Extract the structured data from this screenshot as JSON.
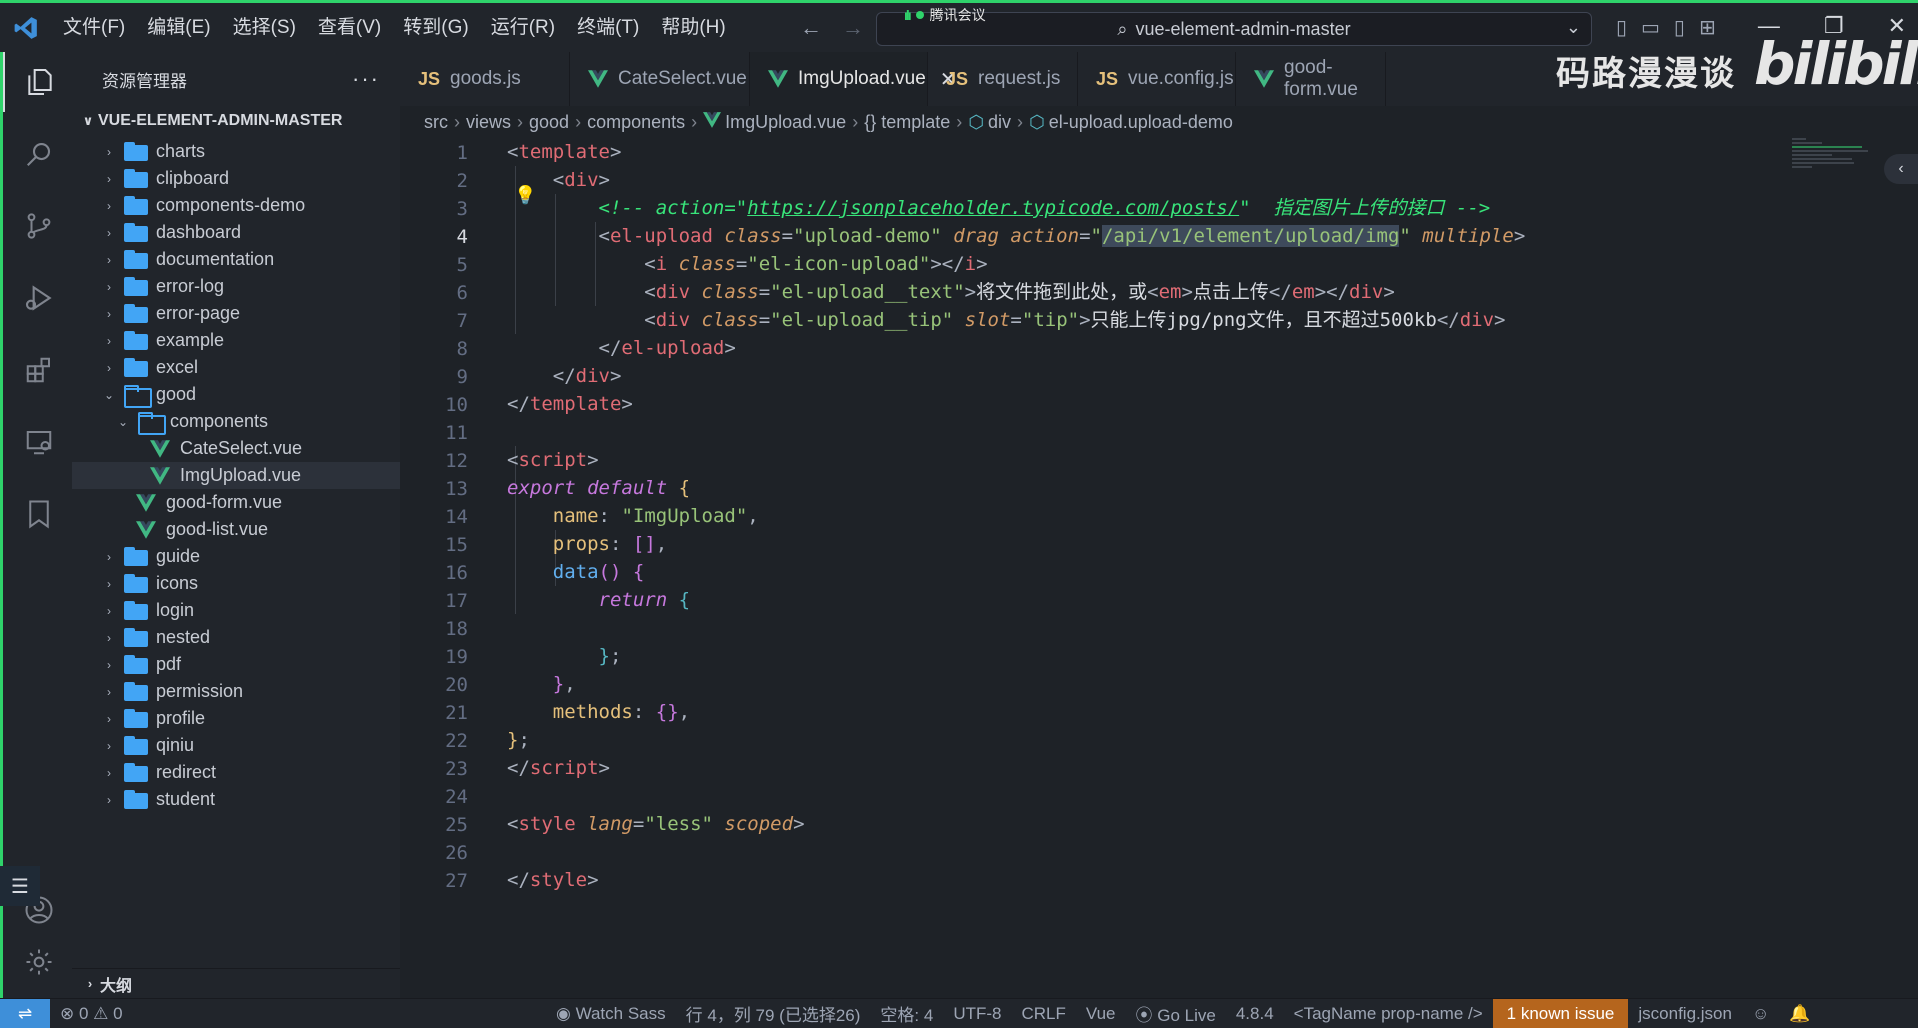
{
  "titlebar": {
    "menu": [
      "文件(F)",
      "编辑(E)",
      "选择(S)",
      "查看(V)",
      "转到(G)",
      "运行(R)",
      "终端(T)",
      "帮助(H)"
    ],
    "meeting_label": "腾讯会议",
    "search_text": "vue-element-admin-master"
  },
  "watermark": {
    "channel": "码路漫漫谈",
    "site": "bilibili"
  },
  "sidebar": {
    "title": "资源管理器",
    "more": "···",
    "root": "VUE-ELEMENT-ADMIN-MASTER",
    "outline": "大纲",
    "tree": [
      {
        "label": "charts",
        "type": "folder",
        "depth": 1
      },
      {
        "label": "clipboard",
        "type": "folder",
        "depth": 1
      },
      {
        "label": "components-demo",
        "type": "folder",
        "depth": 1
      },
      {
        "label": "dashboard",
        "type": "folder",
        "depth": 1
      },
      {
        "label": "documentation",
        "type": "folder",
        "depth": 1
      },
      {
        "label": "error-log",
        "type": "folder",
        "depth": 1
      },
      {
        "label": "error-page",
        "type": "folder",
        "depth": 1
      },
      {
        "label": "example",
        "type": "folder",
        "depth": 1
      },
      {
        "label": "excel",
        "type": "folder",
        "depth": 1
      },
      {
        "label": "good",
        "type": "folder-open",
        "depth": 1
      },
      {
        "label": "components",
        "type": "folder-open",
        "depth": 2
      },
      {
        "label": "CateSelect.vue",
        "type": "vue",
        "depth": 3
      },
      {
        "label": "ImgUpload.vue",
        "type": "vue",
        "depth": 3,
        "selected": true
      },
      {
        "label": "good-form.vue",
        "type": "vue",
        "depth": 2
      },
      {
        "label": "good-list.vue",
        "type": "vue",
        "depth": 2
      },
      {
        "label": "guide",
        "type": "folder",
        "depth": 1
      },
      {
        "label": "icons",
        "type": "folder",
        "depth": 1
      },
      {
        "label": "login",
        "type": "folder",
        "depth": 1
      },
      {
        "label": "nested",
        "type": "folder",
        "depth": 1
      },
      {
        "label": "pdf",
        "type": "folder",
        "depth": 1
      },
      {
        "label": "permission",
        "type": "folder",
        "depth": 1
      },
      {
        "label": "profile",
        "type": "folder",
        "depth": 1
      },
      {
        "label": "qiniu",
        "type": "folder",
        "depth": 1
      },
      {
        "label": "redirect",
        "type": "folder",
        "depth": 1
      },
      {
        "label": "student",
        "type": "folder",
        "depth": 1
      }
    ]
  },
  "tabs": [
    {
      "label": "goods.js",
      "kind": "js"
    },
    {
      "label": "CateSelect.vue",
      "kind": "vue"
    },
    {
      "label": "ImgUpload.vue",
      "kind": "vue",
      "active": true
    },
    {
      "label": "request.js",
      "kind": "js"
    },
    {
      "label": "vue.config.js",
      "kind": "js"
    },
    {
      "label": "good-form.vue",
      "kind": "vue"
    }
  ],
  "breadcrumb": {
    "parts": [
      "src",
      "views",
      "good",
      "components"
    ],
    "file": "ImgUpload.vue",
    "template": "{} template",
    "div": "div",
    "upload": "el-upload.upload-demo"
  },
  "editor": {
    "line_numbers": [
      "1",
      "2",
      "3",
      "4",
      "5",
      "6",
      "7",
      "8",
      "9",
      "10",
      "11",
      "12",
      "13",
      "14",
      "15",
      "16",
      "17",
      "18",
      "19",
      "20",
      "21",
      "22",
      "23",
      "24",
      "25",
      "26",
      "27"
    ],
    "current_line": "4"
  },
  "statusbar": {
    "remote": "⇌",
    "problems": "⊗ 0 ⚠ 0",
    "watch_sass": "Watch Sass",
    "position": "行 4，列 79 (已选择26)",
    "spaces": "空格: 4",
    "encoding": "UTF-8",
    "eol": "CRLF",
    "language": "Vue",
    "go_live": "Go Live",
    "version": "4.8.4",
    "tagname": "<TagName prop-name />",
    "issue": "1 known issue",
    "config": "jsconfig.json"
  },
  "colors": {
    "accent_green": "#2fd36b",
    "folder_blue": "#42a5f5",
    "vue_green": "#41b883",
    "issue_orange": "#b5651d",
    "remote_blue": "#3e8fd9"
  }
}
